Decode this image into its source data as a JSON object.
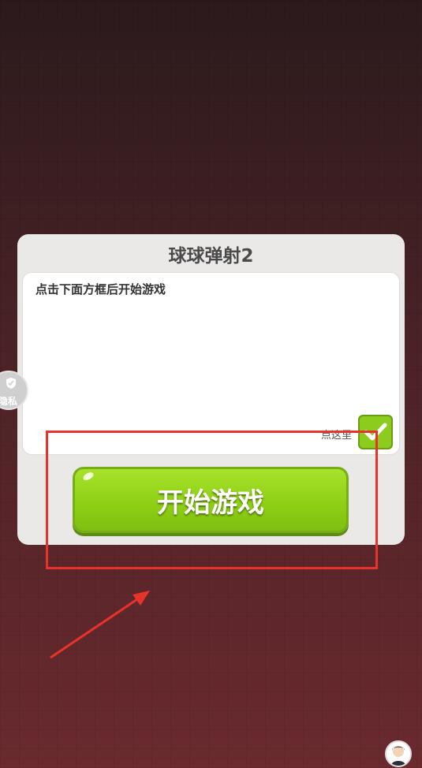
{
  "dialog": {
    "title": "球球弹射2",
    "instruction": "点击下面方框后开始游戏",
    "hint": "点这里",
    "start_button_label": "开始游戏"
  },
  "privacy": {
    "label": "隐私",
    "icon": "shield-icon"
  },
  "colors": {
    "button_green": "#8fd016",
    "annotation_red": "#e8332a",
    "dialog_bg": "#ebe9e8"
  }
}
